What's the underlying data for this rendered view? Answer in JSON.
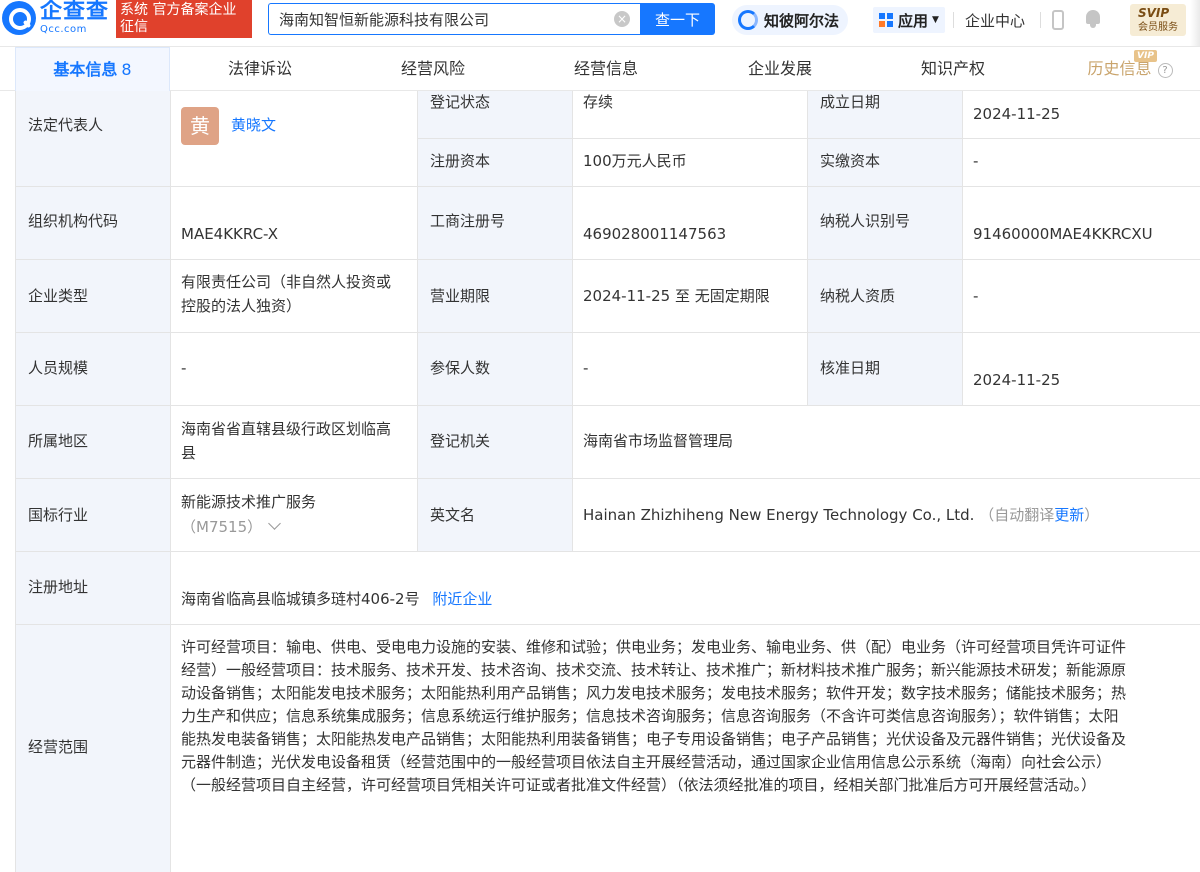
{
  "header": {
    "logo_cn": "企查查",
    "logo_en": "Qcc.com",
    "logo_badge": "系统 官方备案企业征信",
    "search_value": "海南知智恒新能源科技有限公司",
    "search_button": "查一下",
    "alpha_label": "知彼阿尔法",
    "apps_label": "应用",
    "enterprise_center": "企业中心",
    "svip_title": "SVIP",
    "svip_sub": "会员服务"
  },
  "tabs": [
    {
      "label": "基本信息",
      "count": "8"
    },
    {
      "label": "法律诉讼"
    },
    {
      "label": "经营风险"
    },
    {
      "label": "经营信息"
    },
    {
      "label": "企业发展"
    },
    {
      "label": "知识产权"
    },
    {
      "label": "历史信息",
      "tag": "VIP"
    }
  ],
  "info": {
    "legal_rep_label": "法定代表人",
    "legal_rep_avatar": "黄",
    "legal_rep_name": "黄晓文",
    "reg_status_label": "登记状态",
    "reg_status": "存续",
    "found_date_label": "成立日期",
    "found_date": "2024-11-25",
    "reg_capital_label": "注册资本",
    "reg_capital": "100万元人民币",
    "paid_capital_label": "实缴资本",
    "paid_capital": "-",
    "org_code_label": "组织机构代码",
    "org_code": "MAE4KKRC-X",
    "biz_reg_no_label": "工商注册号",
    "biz_reg_no": "469028001147563",
    "taxpayer_id_label": "纳税人识别号",
    "taxpayer_id": "91460000MAE4KKRCXU",
    "company_type_label": "企业类型",
    "company_type_line1": "有限责任公司（非自然人投资或",
    "company_type_line2": "控股的法人独资）",
    "term_label": "营业期限",
    "term": "2024-11-25 至 无固定期限",
    "taxpayer_qual_label": "纳税人资质",
    "taxpayer_qual": "-",
    "staff_label": "人员规模",
    "staff": "-",
    "insured_label": "参保人数",
    "insured": "-",
    "approve_date_label": "核准日期",
    "approve_date": "2024-11-25",
    "region_label": "所属地区",
    "region_line1": "海南省省直辖县级行政区划临高",
    "region_line2": "县",
    "authority_label": "登记机关",
    "authority": "海南省市场监督管理局",
    "industry_label": "国标行业",
    "industry": "新能源技术推广服务",
    "industry_code": "（M7515）",
    "en_name_label": "英文名",
    "en_name": "Hainan Zhizhiheng New Energy Technology Co., Ltd.",
    "en_name_note": "（自动翻译",
    "en_name_update": "更新",
    "en_name_close": "）",
    "address_label": "注册地址",
    "address": "海南省临高县临城镇多琏村406-2号",
    "address_nearby": "附近企业",
    "scope_label": "经营范围",
    "scope_lines": [
      "许可经营项目：输电、供电、受电电力设施的安装、维修和试验；供电业务；发电业务、输电业务、供（配）电业务（许可经营项目凭许可证件",
      "经营）一般经营项目：技术服务、技术开发、技术咨询、技术交流、技术转让、技术推广；新材料技术推广服务；新兴能源技术研发；新能源原",
      "动设备销售；太阳能发电技术服务；太阳能热利用产品销售；风力发电技术服务；发电技术服务；软件开发；数字技术服务；储能技术服务；热",
      "力生产和供应；信息系统集成服务；信息系统运行维护服务；信息技术咨询服务；信息咨询服务（不含许可类信息咨询服务）；软件销售；太阳",
      "能热发电装备销售；太阳能热发电产品销售；太阳能热利用装备销售；电子专用设备销售；电子产品销售；光伏设备及元器件销售；光伏设备及",
      "元器件制造；光伏发电设备租赁（经营范围中的一般经营项目依法自主开展经营活动，通过国家企业信用信息公示系统（海南）向社会公示）",
      "（一般经营项目自主经营，许可经营项目凭相关许可证或者批准文件经营）（依法须经批准的项目，经相关部门批准后方可开展经营活动。）"
    ]
  }
}
